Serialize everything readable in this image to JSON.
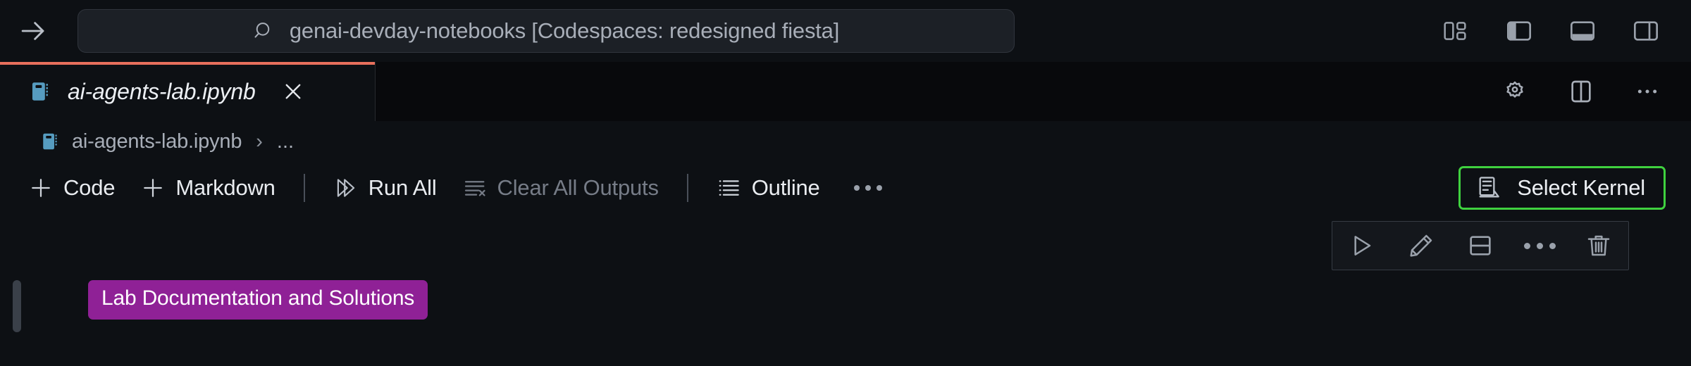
{
  "window": {
    "titlebar": {
      "nav_forward_icon": "arrow-right-icon",
      "command_center": {
        "search_icon": "search-icon",
        "text": "genai-devday-notebooks [Codespaces: redesigned fiesta]",
        "placeholder": "Search"
      },
      "actions": [
        {
          "name": "customize-layout-icon",
          "label": "Customize Layout"
        },
        {
          "name": "toggle-primary-sidebar-icon",
          "label": "Toggle Primary Side Bar"
        },
        {
          "name": "toggle-panel-icon",
          "label": "Toggle Panel"
        },
        {
          "name": "toggle-secondary-sidebar-icon",
          "label": "Toggle Secondary Side Bar"
        }
      ]
    }
  },
  "tabbar": {
    "tabs": [
      {
        "label": "ai-agents-lab.ipynb",
        "icon": "notebook-icon",
        "active": true,
        "preview": true,
        "close_icon": "close-icon",
        "active_border_color": "#e8705c"
      }
    ],
    "actions": [
      {
        "name": "notebook-settings-icon",
        "label": "Notebook Settings"
      },
      {
        "name": "split-editor-icon",
        "label": "Split Editor Right"
      },
      {
        "name": "editor-more-actions-icon",
        "label": "More Actions..."
      }
    ]
  },
  "breadcrumb": {
    "icon": "notebook-icon",
    "file": "ai-agents-lab.ipynb",
    "separator": "›",
    "ellipsis": "..."
  },
  "notebook_toolbar": {
    "items": [
      {
        "name": "add-code-cell-button",
        "label": "Code",
        "icon": "plus-icon",
        "disabled": false
      },
      {
        "name": "add-markdown-cell-button",
        "label": "Markdown",
        "icon": "plus-icon",
        "disabled": false
      },
      {
        "name": "run-all-button",
        "label": "Run All",
        "icon": "run-all-icon",
        "disabled": false
      },
      {
        "name": "clear-all-outputs-button",
        "label": "Clear All Outputs",
        "icon": "clear-all-icon",
        "disabled": true
      },
      {
        "name": "outline-button",
        "label": "Outline",
        "icon": "list-icon",
        "disabled": false
      }
    ],
    "more_label": "...",
    "kernel": {
      "label": "Select Kernel",
      "icon": "kernel-icon",
      "focus_border_color": "#3fd13f"
    }
  },
  "notebook_body": {
    "cell_toolbar": [
      {
        "name": "run-cell-button",
        "icon": "play-icon",
        "label": "Execute Cell"
      },
      {
        "name": "edit-cell-button",
        "icon": "pencil-icon",
        "label": "Edit Cell"
      },
      {
        "name": "split-cell-button",
        "icon": "split-cell-icon",
        "label": "Split Cell"
      },
      {
        "name": "cell-more-actions-button",
        "icon": "ellipsis-icon",
        "label": "More Actions"
      },
      {
        "name": "delete-cell-button",
        "icon": "trash-icon",
        "label": "Delete Cell"
      }
    ],
    "cells": [
      {
        "type": "markdown",
        "badge_text": "Lab Documentation and Solutions",
        "badge_color": "#8f2196",
        "badge_text_color": "#ffffff",
        "focused": true
      }
    ]
  },
  "colors": {
    "background": "#0d1014",
    "tabbar_background": "#08090c",
    "command_center_background": "#1c2026",
    "foreground": "#e9ecf0",
    "muted_foreground": "#a8aeb8",
    "disabled_foreground": "#767c87",
    "accent_tab_border": "#e8705c",
    "kernel_focus_green": "#3fd13f",
    "markdown_badge_purple": "#8f2196",
    "notebook_icon_blue": "#569cc0"
  }
}
